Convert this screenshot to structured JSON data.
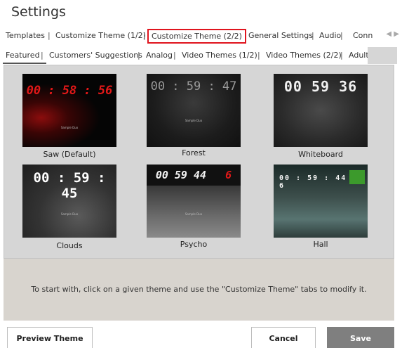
{
  "window": {
    "title": "Settings"
  },
  "main_tabs": [
    {
      "label": "Templates"
    },
    {
      "label": "Customize Theme  (1/2)"
    },
    {
      "label": "Customize Theme  (2/2)",
      "active": true
    },
    {
      "label": "General Settings"
    },
    {
      "label": "Audio"
    },
    {
      "label": "Conn"
    }
  ],
  "tab_scroll": {
    "left": "◀",
    "right": "▶"
  },
  "sub_tabs": [
    {
      "label": "Featured",
      "active": true
    },
    {
      "label": "Customers' Suggestions"
    },
    {
      "label": "Analog"
    },
    {
      "label": "Video Themes (1/2)"
    },
    {
      "label": "Video Themes (2/2)"
    },
    {
      "label": "Adult"
    }
  ],
  "themes": [
    {
      "name": "Saw (Default)",
      "clock": "00 : 58 : 56",
      "sample": "Sample Duo"
    },
    {
      "name": "Forest",
      "clock": "00 : 59 : 47",
      "sample": "Sample Duo"
    },
    {
      "name": "Whiteboard",
      "clock": "00  59  36",
      "sample": ""
    },
    {
      "name": "Clouds",
      "clock": "00 : 59 : 45",
      "sample": "Sample Duo"
    },
    {
      "name": "Psycho",
      "clock": "00 59 44",
      "clock_accent": "6",
      "sample": "Sample Duo"
    },
    {
      "name": "Hall",
      "clock": "00 : 59 : 44 : 6",
      "sample": ""
    }
  ],
  "info": {
    "text": "To start with, click on a given theme and use the \"Customize Theme\" tabs to modify it."
  },
  "buttons": {
    "preview": "Preview Theme",
    "cancel": "Cancel",
    "save": "Save"
  },
  "colors": {
    "active_tab_border": "#e0141e",
    "save_button": "#7f7f7f",
    "gallery_bg": "#d6d6d6",
    "info_bg": "#d8d4ce"
  }
}
